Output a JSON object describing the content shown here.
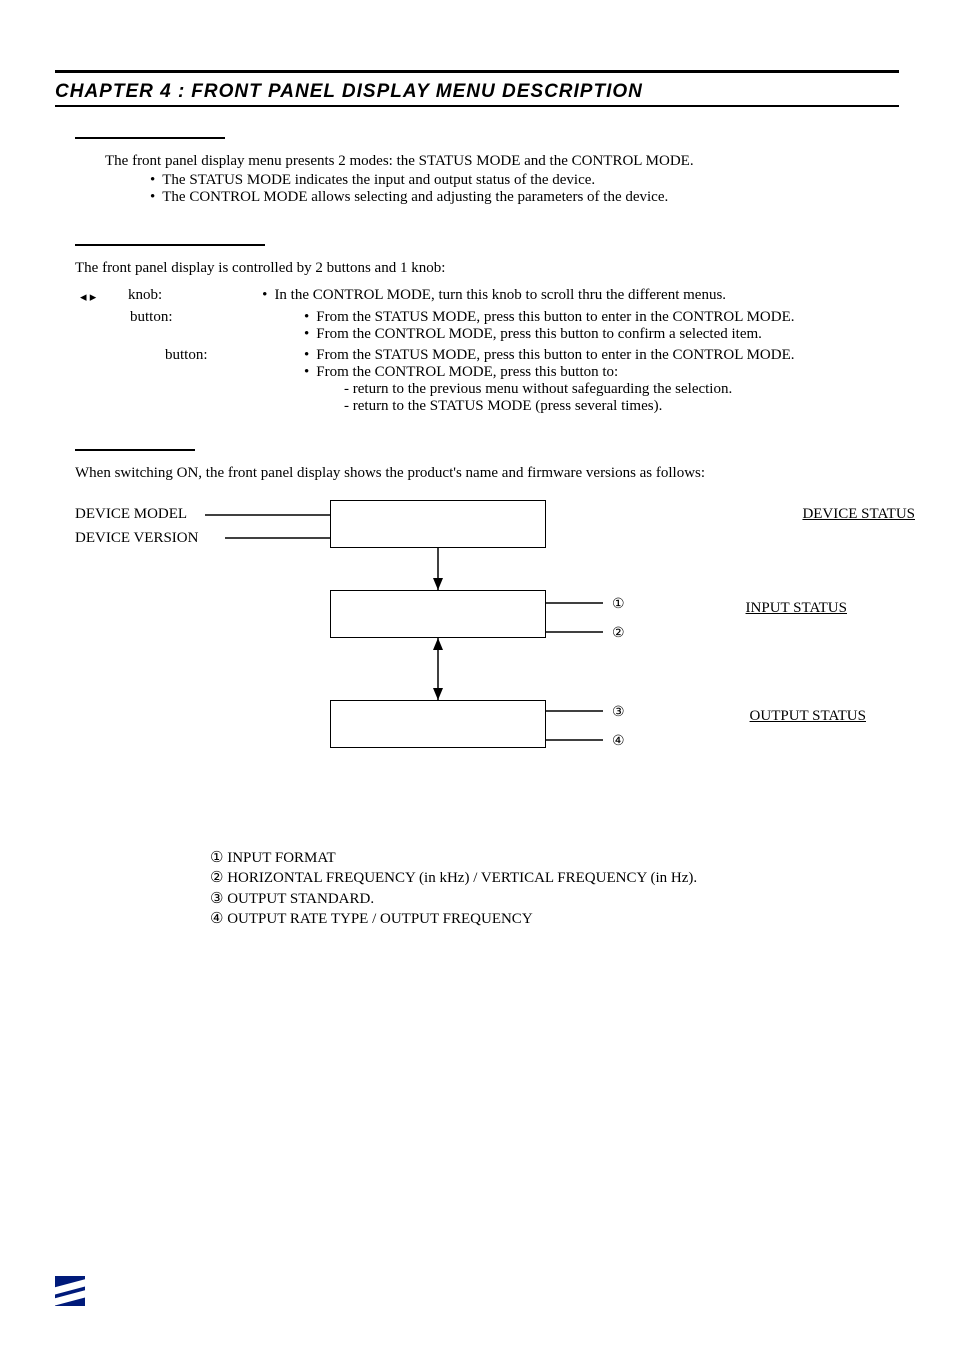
{
  "header": {
    "chapter_label": "Chapter 4 :",
    "chapter_title": "FRONT PANEL DISPLAY MENU DESCRIPTION"
  },
  "intro": {
    "line1": "The front panel display menu presents 2 modes: the STATUS MODE and the CONTROL MODE.",
    "b1": "The STATUS MODE indicates the input and output status of the device.",
    "b2": "The CONTROL MODE allows selecting and adjusting the parameters of the device."
  },
  "controls": {
    "intro": "The front panel display is controlled by 2 buttons and 1 knob:",
    "knob_glyph": "◂  ▸",
    "knob_label": "knob:",
    "knob_desc": "In the CONTROL MODE, turn this knob to scroll thru the different menus.",
    "btn1_label": "button:",
    "btn1_l1": "From the STATUS MODE, press this button to enter in the CONTROL MODE.",
    "btn1_l2": "From the CONTROL MODE, press this button to confirm a selected item.",
    "btn2_label": "button:",
    "btn2_l1": "From the STATUS MODE, press this button to enter in the CONTROL MODE.",
    "btn2_l2": "From the CONTROL MODE, press this button to:",
    "btn2_s1": "- return to the previous menu without safeguarding the selection.",
    "btn2_s2": "- return to the STATUS MODE (press several times)."
  },
  "status": {
    "intro": "When switching ON, the front panel display shows the product's name and firmware versions as follows:"
  },
  "diagram": {
    "device_model": "DEVICE MODEL",
    "device_version": "DEVICE VERSION",
    "device_status": "DEVICE STATUS",
    "input_status": "INPUT STATUS",
    "output_status": "OUTPUT STATUS",
    "c1": "①",
    "c2": "②",
    "c3": "③",
    "c4": "④"
  },
  "legend": {
    "l1g": "①",
    "l1t": " INPUT FORMAT",
    "l2g": "②",
    "l2t": " HORIZONTAL FREQUENCY (in kHz) / VERTICAL FREQUENCY (in Hz).",
    "l3g": "③",
    "l3t": " OUTPUT STANDARD.",
    "l4g": "④",
    "l4t": " OUTPUT RATE TYPE / OUTPUT FREQUENCY"
  }
}
